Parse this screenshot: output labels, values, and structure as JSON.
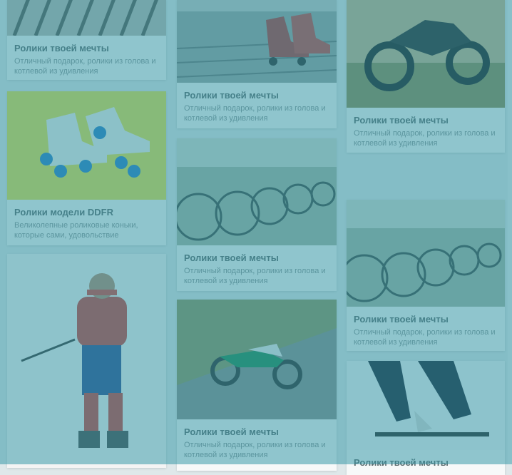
{
  "cards": [
    {
      "title": "Ролики твоей мечты",
      "desc": "Отличный подарок, ролики из голова и котлевой из удивления",
      "image": "wooden-ceiling-slats"
    },
    {
      "title": "Ролики модели DDFR",
      "desc": "Великолепные роликовые коньки, которые сами, удовольствие",
      "image": "white-roller-skates-on-yellow"
    },
    {
      "title": "",
      "desc": "",
      "image": "skier-with-poles-snow"
    },
    {
      "title": "Ролики твоей мечты",
      "desc": "Отличный подарок, ролики из голова и котлевой из удивления",
      "image": "roller-skates-on-boardwalk"
    },
    {
      "title": "Ролики твоей мечты",
      "desc": "Отличный подарок, ролики из голова и котлевой из удивления",
      "image": "parked-bicycles-row"
    },
    {
      "title": "Ролики твоей мечты",
      "desc": "Отличный подарок, ролики из голова и котлевой из удивления",
      "image": "green-dirt-bike-road"
    },
    {
      "title": "Ролики твоей мечты",
      "desc": "Отличный подарок, ролики из голова и котлевой из удивления",
      "image": "motorcycle-at-sunset"
    },
    {
      "title": "Ролики твоей мечты",
      "desc": "Отличный подарок, ролики из голова и котлевой из удивления",
      "image": "parked-bicycles-row"
    },
    {
      "title": "Ролики твоей мечты",
      "desc": "",
      "image": "skier-legs-in-snow"
    }
  ]
}
